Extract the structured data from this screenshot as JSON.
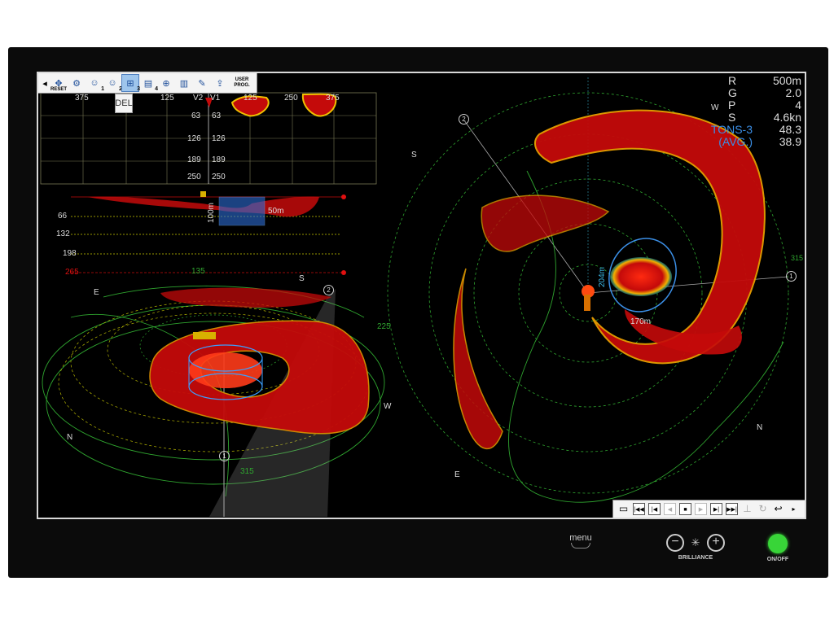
{
  "toolbar": {
    "buttons": [
      {
        "name": "collapse",
        "glyph": "◂"
      },
      {
        "name": "reset",
        "glyph": "✥",
        "label": "RESET"
      },
      {
        "name": "settings",
        "glyph": "⚙"
      },
      {
        "name": "mode-1",
        "glyph": "☺",
        "sub": "1"
      },
      {
        "name": "mode-2",
        "glyph": "☺",
        "sub": "2"
      },
      {
        "name": "mode-3",
        "glyph": "⊞",
        "sub": "3",
        "selected": true
      },
      {
        "name": "mode-4",
        "glyph": "▤",
        "sub": "4"
      },
      {
        "name": "target",
        "glyph": "⊕"
      },
      {
        "name": "database",
        "glyph": "▥"
      },
      {
        "name": "probe",
        "glyph": "✎"
      },
      {
        "name": "export",
        "glyph": "⇪"
      }
    ],
    "user_prog_label": "USER PROG.",
    "popup_label": "DEL"
  },
  "readout": {
    "rows": [
      {
        "key": "R",
        "value": "500m"
      },
      {
        "key": "G",
        "value": "2.0"
      },
      {
        "key": "P",
        "value": "4"
      },
      {
        "key": "S",
        "value": "4.6kn"
      }
    ],
    "tons_label": "TONS-3",
    "tons_value": "48.3",
    "avg_label": "(AVG.)",
    "avg_value": "38.9"
  },
  "vscan": {
    "left_ticks": [
      "375",
      "125"
    ],
    "right_ticks": [
      "125",
      "250",
      "375"
    ],
    "v_labels": [
      "V2",
      "V1"
    ],
    "depths": [
      "63",
      "126",
      "189",
      "250"
    ]
  },
  "side_view": {
    "depths": [
      "66",
      "132",
      "198",
      "265"
    ],
    "box_height": "100m",
    "box_width": "50m"
  },
  "view3d": {
    "compass": {
      "E": "E",
      "S": "S",
      "W": "W",
      "N": "N"
    },
    "bearings": [
      "135",
      "225",
      "315"
    ],
    "markers": [
      "1",
      "2"
    ]
  },
  "plan": {
    "compass": {
      "S": "S",
      "W": "W",
      "N": "N",
      "E": "E"
    },
    "bearing": "315",
    "markers": [
      "1",
      "2"
    ],
    "ring_label_v": "204m",
    "ring_label_h": "170m"
  },
  "playback": {
    "buttons": [
      "open",
      "skip-start",
      "prev",
      "step-back",
      "stop",
      "step-forward",
      "next",
      "skip-end",
      "mark",
      "history",
      "undo",
      "expand"
    ]
  },
  "controls": {
    "menu_label": "menu",
    "brilliance_label": "BRILLIANCE",
    "power_label": "ON/OFF"
  },
  "colors": {
    "echo": "#c40a0a",
    "grid": "#2fa52f",
    "accent": "#3b8fe6",
    "power": "#38d538"
  }
}
